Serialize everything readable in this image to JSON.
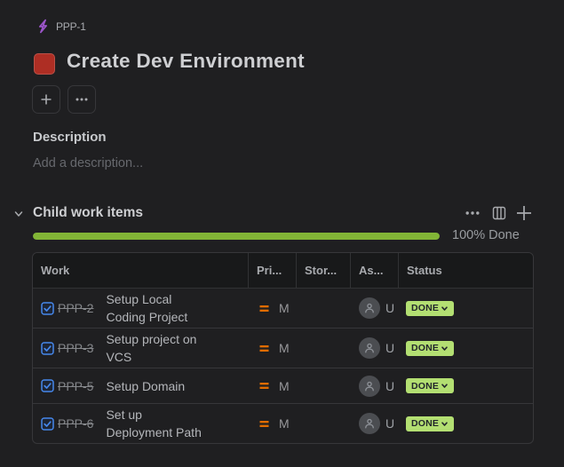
{
  "breadcrumb": {
    "key": "PPP-1"
  },
  "page": {
    "title": "Create Dev Environment"
  },
  "toolbar": {
    "add_label": "+",
    "more_label": "..."
  },
  "description": {
    "heading": "Description",
    "placeholder": "Add a description..."
  },
  "child_items": {
    "heading": "Child work items",
    "progress_percent": 100,
    "progress_label": "100% Done",
    "columns": {
      "work": "Work",
      "priority": "Pri...",
      "story": "Stor...",
      "assignee": "As...",
      "status": "Status"
    },
    "rows": [
      {
        "key": "PPP-2",
        "name": "Setup Local Coding Project",
        "priority": "M",
        "assignee": "U",
        "status": "DONE"
      },
      {
        "key": "PPP-3",
        "name": "Setup project on VCS",
        "priority": "M",
        "assignee": "U",
        "status": "DONE"
      },
      {
        "key": "PPP-5",
        "name": "Setup Domain",
        "priority": "M",
        "assignee": "U",
        "status": "DONE"
      },
      {
        "key": "PPP-6",
        "name": "Set up Deployment Path",
        "priority": "M",
        "assignee": "U",
        "status": "DONE"
      }
    ]
  },
  "colors": {
    "background": "#1f1f21",
    "accent_red": "#ae2e24",
    "accent_purple": "#a263d6",
    "progress_green": "#82b536",
    "badge_green": "#b3df72",
    "checkbox_blue": "#4688ec",
    "priority_orange": "#e06c00"
  }
}
